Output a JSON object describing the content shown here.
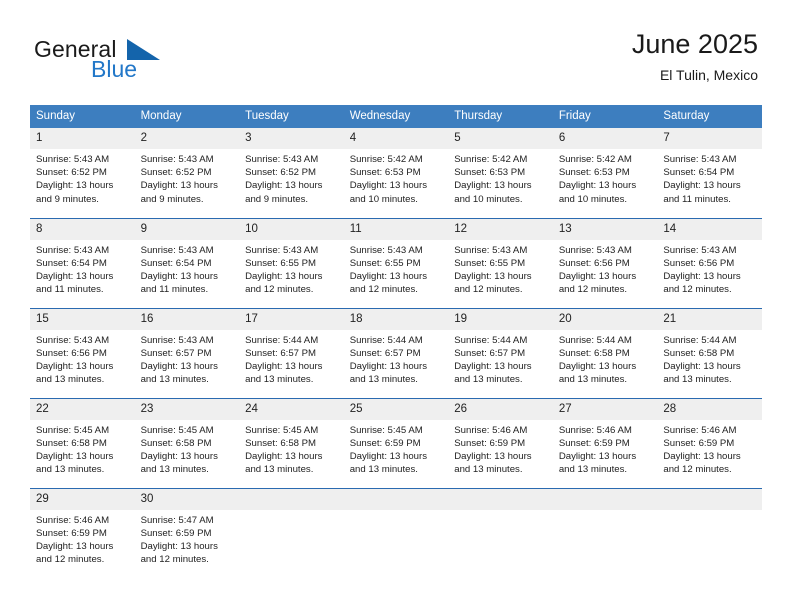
{
  "brand": {
    "name_part1": "General",
    "name_part2": "Blue",
    "logo_icon": "blue-triangle-icon"
  },
  "header": {
    "title": "June 2025",
    "subtitle": "El Tulin, Mexico"
  },
  "colors": {
    "header_blue": "#3d7ebf",
    "separator_blue": "#2a6ab0",
    "daynum_band": "#efefef",
    "brand_blue": "#2277c8",
    "logo_blue": "#1464ab",
    "text": "#222222"
  },
  "weekday_headers": [
    "Sunday",
    "Monday",
    "Tuesday",
    "Wednesday",
    "Thursday",
    "Friday",
    "Saturday"
  ],
  "weeks": [
    {
      "days": [
        {
          "date": "1",
          "sunrise": "Sunrise: 5:43 AM",
          "sunset": "Sunset: 6:52 PM",
          "daylight_line1": "Daylight: 13 hours",
          "daylight_line2": "and 9 minutes."
        },
        {
          "date": "2",
          "sunrise": "Sunrise: 5:43 AM",
          "sunset": "Sunset: 6:52 PM",
          "daylight_line1": "Daylight: 13 hours",
          "daylight_line2": "and 9 minutes."
        },
        {
          "date": "3",
          "sunrise": "Sunrise: 5:43 AM",
          "sunset": "Sunset: 6:52 PM",
          "daylight_line1": "Daylight: 13 hours",
          "daylight_line2": "and 9 minutes."
        },
        {
          "date": "4",
          "sunrise": "Sunrise: 5:42 AM",
          "sunset": "Sunset: 6:53 PM",
          "daylight_line1": "Daylight: 13 hours",
          "daylight_line2": "and 10 minutes."
        },
        {
          "date": "5",
          "sunrise": "Sunrise: 5:42 AM",
          "sunset": "Sunset: 6:53 PM",
          "daylight_line1": "Daylight: 13 hours",
          "daylight_line2": "and 10 minutes."
        },
        {
          "date": "6",
          "sunrise": "Sunrise: 5:42 AM",
          "sunset": "Sunset: 6:53 PM",
          "daylight_line1": "Daylight: 13 hours",
          "daylight_line2": "and 10 minutes."
        },
        {
          "date": "7",
          "sunrise": "Sunrise: 5:43 AM",
          "sunset": "Sunset: 6:54 PM",
          "daylight_line1": "Daylight: 13 hours",
          "daylight_line2": "and 11 minutes."
        }
      ]
    },
    {
      "days": [
        {
          "date": "8",
          "sunrise": "Sunrise: 5:43 AM",
          "sunset": "Sunset: 6:54 PM",
          "daylight_line1": "Daylight: 13 hours",
          "daylight_line2": "and 11 minutes."
        },
        {
          "date": "9",
          "sunrise": "Sunrise: 5:43 AM",
          "sunset": "Sunset: 6:54 PM",
          "daylight_line1": "Daylight: 13 hours",
          "daylight_line2": "and 11 minutes."
        },
        {
          "date": "10",
          "sunrise": "Sunrise: 5:43 AM",
          "sunset": "Sunset: 6:55 PM",
          "daylight_line1": "Daylight: 13 hours",
          "daylight_line2": "and 12 minutes."
        },
        {
          "date": "11",
          "sunrise": "Sunrise: 5:43 AM",
          "sunset": "Sunset: 6:55 PM",
          "daylight_line1": "Daylight: 13 hours",
          "daylight_line2": "and 12 minutes."
        },
        {
          "date": "12",
          "sunrise": "Sunrise: 5:43 AM",
          "sunset": "Sunset: 6:55 PM",
          "daylight_line1": "Daylight: 13 hours",
          "daylight_line2": "and 12 minutes."
        },
        {
          "date": "13",
          "sunrise": "Sunrise: 5:43 AM",
          "sunset": "Sunset: 6:56 PM",
          "daylight_line1": "Daylight: 13 hours",
          "daylight_line2": "and 12 minutes."
        },
        {
          "date": "14",
          "sunrise": "Sunrise: 5:43 AM",
          "sunset": "Sunset: 6:56 PM",
          "daylight_line1": "Daylight: 13 hours",
          "daylight_line2": "and 12 minutes."
        }
      ]
    },
    {
      "days": [
        {
          "date": "15",
          "sunrise": "Sunrise: 5:43 AM",
          "sunset": "Sunset: 6:56 PM",
          "daylight_line1": "Daylight: 13 hours",
          "daylight_line2": "and 13 minutes."
        },
        {
          "date": "16",
          "sunrise": "Sunrise: 5:43 AM",
          "sunset": "Sunset: 6:57 PM",
          "daylight_line1": "Daylight: 13 hours",
          "daylight_line2": "and 13 minutes."
        },
        {
          "date": "17",
          "sunrise": "Sunrise: 5:44 AM",
          "sunset": "Sunset: 6:57 PM",
          "daylight_line1": "Daylight: 13 hours",
          "daylight_line2": "and 13 minutes."
        },
        {
          "date": "18",
          "sunrise": "Sunrise: 5:44 AM",
          "sunset": "Sunset: 6:57 PM",
          "daylight_line1": "Daylight: 13 hours",
          "daylight_line2": "and 13 minutes."
        },
        {
          "date": "19",
          "sunrise": "Sunrise: 5:44 AM",
          "sunset": "Sunset: 6:57 PM",
          "daylight_line1": "Daylight: 13 hours",
          "daylight_line2": "and 13 minutes."
        },
        {
          "date": "20",
          "sunrise": "Sunrise: 5:44 AM",
          "sunset": "Sunset: 6:58 PM",
          "daylight_line1": "Daylight: 13 hours",
          "daylight_line2": "and 13 minutes."
        },
        {
          "date": "21",
          "sunrise": "Sunrise: 5:44 AM",
          "sunset": "Sunset: 6:58 PM",
          "daylight_line1": "Daylight: 13 hours",
          "daylight_line2": "and 13 minutes."
        }
      ]
    },
    {
      "days": [
        {
          "date": "22",
          "sunrise": "Sunrise: 5:45 AM",
          "sunset": "Sunset: 6:58 PM",
          "daylight_line1": "Daylight: 13 hours",
          "daylight_line2": "and 13 minutes."
        },
        {
          "date": "23",
          "sunrise": "Sunrise: 5:45 AM",
          "sunset": "Sunset: 6:58 PM",
          "daylight_line1": "Daylight: 13 hours",
          "daylight_line2": "and 13 minutes."
        },
        {
          "date": "24",
          "sunrise": "Sunrise: 5:45 AM",
          "sunset": "Sunset: 6:58 PM",
          "daylight_line1": "Daylight: 13 hours",
          "daylight_line2": "and 13 minutes."
        },
        {
          "date": "25",
          "sunrise": "Sunrise: 5:45 AM",
          "sunset": "Sunset: 6:59 PM",
          "daylight_line1": "Daylight: 13 hours",
          "daylight_line2": "and 13 minutes."
        },
        {
          "date": "26",
          "sunrise": "Sunrise: 5:46 AM",
          "sunset": "Sunset: 6:59 PM",
          "daylight_line1": "Daylight: 13 hours",
          "daylight_line2": "and 13 minutes."
        },
        {
          "date": "27",
          "sunrise": "Sunrise: 5:46 AM",
          "sunset": "Sunset: 6:59 PM",
          "daylight_line1": "Daylight: 13 hours",
          "daylight_line2": "and 13 minutes."
        },
        {
          "date": "28",
          "sunrise": "Sunrise: 5:46 AM",
          "sunset": "Sunset: 6:59 PM",
          "daylight_line1": "Daylight: 13 hours",
          "daylight_line2": "and 12 minutes."
        }
      ]
    },
    {
      "days": [
        {
          "date": "29",
          "sunrise": "Sunrise: 5:46 AM",
          "sunset": "Sunset: 6:59 PM",
          "daylight_line1": "Daylight: 13 hours",
          "daylight_line2": "and 12 minutes."
        },
        {
          "date": "30",
          "sunrise": "Sunrise: 5:47 AM",
          "sunset": "Sunset: 6:59 PM",
          "daylight_line1": "Daylight: 13 hours",
          "daylight_line2": "and 12 minutes."
        },
        {
          "date": "",
          "sunrise": "",
          "sunset": "",
          "daylight_line1": "",
          "daylight_line2": ""
        },
        {
          "date": "",
          "sunrise": "",
          "sunset": "",
          "daylight_line1": "",
          "daylight_line2": ""
        },
        {
          "date": "",
          "sunrise": "",
          "sunset": "",
          "daylight_line1": "",
          "daylight_line2": ""
        },
        {
          "date": "",
          "sunrise": "",
          "sunset": "",
          "daylight_line1": "",
          "daylight_line2": ""
        },
        {
          "date": "",
          "sunrise": "",
          "sunset": "",
          "daylight_line1": "",
          "daylight_line2": ""
        }
      ]
    }
  ]
}
